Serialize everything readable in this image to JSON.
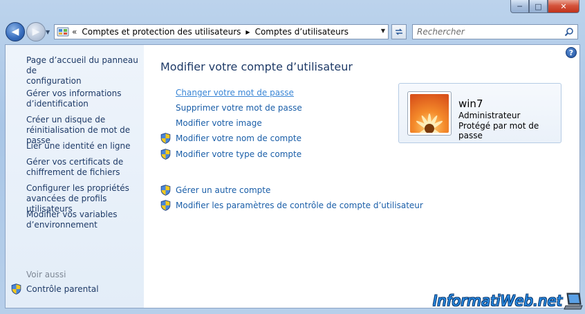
{
  "window": {
    "caption": {
      "minimize": "─",
      "maximize": "□",
      "close": "✕"
    }
  },
  "navigation": {
    "back_icon": "back-arrow-icon",
    "forward_icon": "forward-arrow-icon",
    "address": {
      "chevron": "«",
      "crumb_1": "Comptes et protection des utilisateurs",
      "crumb_2": "Comptes d’utilisateurs"
    },
    "search_placeholder": "Rechercher"
  },
  "sidebar": {
    "items": [
      {
        "line1": "Page d’accueil du panneau de",
        "line2": "configuration"
      },
      {
        "line1": "Gérer vos informations",
        "line2": "d’identification"
      },
      {
        "line1": "Créer un disque de",
        "line2": "réinitialisation de mot de passe"
      },
      {
        "line1": "Lier une identité en ligne",
        "line2": ""
      },
      {
        "line1": "Gérer vos certificats de",
        "line2": "chiffrement de fichiers"
      },
      {
        "line1": "Configurer les propriétés",
        "line2": "avancées de profils utilisateurs"
      },
      {
        "line1": "Modifier vos variables",
        "line2": "d’environnement"
      }
    ],
    "see_also": "Voir aussi",
    "parental": "Contrôle parental"
  },
  "main": {
    "title": "Modifier votre compte d’utilisateur",
    "tasks": [
      "Changer votre mot de passe",
      "Supprimer votre mot de passe",
      "Modifier votre image",
      "Modifier votre nom de compte",
      "Modifier votre type de compte"
    ],
    "other_tasks": [
      "Gérer un autre compte",
      "Modifier les paramètres de contrôle de compte d’utilisateur"
    ],
    "help": "?"
  },
  "user": {
    "name": "win7",
    "role": "Administrateur",
    "protection": "Protégé par mot de passe"
  },
  "watermark": "InformatiWeb.net",
  "colors": {
    "link": "#1a5ea8",
    "heading": "#1e3a67",
    "sidebar_bg": "#e6eff9"
  }
}
